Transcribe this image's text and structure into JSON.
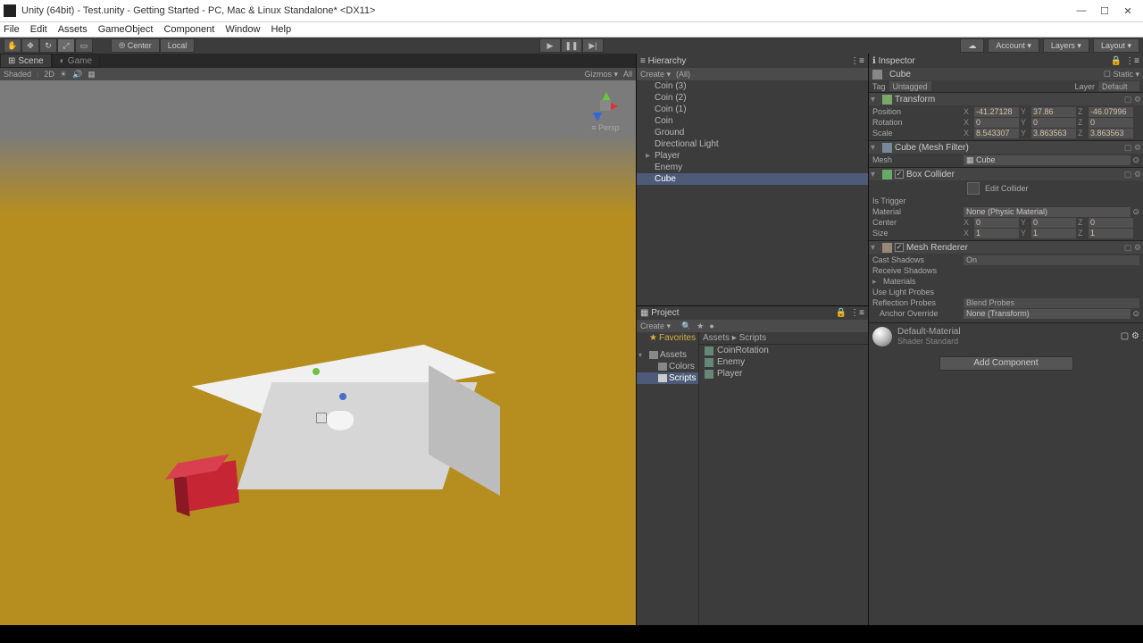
{
  "window": {
    "title": "Unity (64bit) - Test.unity - Getting Started - PC, Mac & Linux Standalone* <DX11>"
  },
  "menu": [
    "File",
    "Edit",
    "Assets",
    "GameObject",
    "Component",
    "Window",
    "Help"
  ],
  "toolbar": {
    "pivot1": "⦾ Center",
    "pivot2": "Local",
    "account": "Account ▾",
    "layers": "Layers ▾",
    "layout": "Layout ▾"
  },
  "tabs": {
    "scene": "Scene",
    "game": "Game"
  },
  "sceneBar": {
    "shaded": "Shaded",
    "twod": "2D",
    "persp": "≡ Persp",
    "gizmos": "Gizmos ▾",
    "search": "All"
  },
  "hierarchy": {
    "title": "Hierarchy",
    "create": "Create ▾",
    "search": "(All)",
    "items": [
      "Coin (3)",
      "Coin (2)",
      "Coin (1)",
      "Coin",
      "Ground",
      "Directional Light",
      "Player",
      "Enemy",
      "Cube"
    ]
  },
  "project": {
    "title": "Project",
    "create": "Create ▾",
    "favorites": "Favorites",
    "assets": "Assets",
    "folders": [
      "Colors",
      "Scripts"
    ],
    "crumb": "Assets ▸ Scripts",
    "files": [
      "CoinRotation",
      "Enemy",
      "Player"
    ]
  },
  "inspector": {
    "title": "Inspector",
    "obj": "Cube",
    "static": "Static ▾",
    "tagLbl": "Tag",
    "tagVal": "Untagged",
    "layerLbl": "Layer",
    "layerVal": "Default",
    "transform": {
      "name": "Transform",
      "position": {
        "lbl": "Position",
        "x": "-41.27128",
        "y": "37.86",
        "z": "-46.07996"
      },
      "rotation": {
        "lbl": "Rotation",
        "x": "0",
        "y": "0",
        "z": "0"
      },
      "scale": {
        "lbl": "Scale",
        "x": "8.543307",
        "y": "3.863563",
        "z": "3.863563"
      }
    },
    "meshFilter": {
      "name": "Cube (Mesh Filter)",
      "meshLbl": "Mesh",
      "meshVal": "Cube"
    },
    "boxCollider": {
      "name": "Box Collider",
      "editLbl": "Edit Collider",
      "isTriggerLbl": "Is Trigger",
      "materialLbl": "Material",
      "materialVal": "None (Physic Material)",
      "centerLbl": "Center",
      "cx": "0",
      "cy": "0",
      "cz": "0",
      "sizeLbl": "Size",
      "sx": "1",
      "sy": "1",
      "sz": "1"
    },
    "meshRenderer": {
      "name": "Mesh Renderer",
      "castLbl": "Cast Shadows",
      "castVal": "On",
      "recvLbl": "Receive Shadows",
      "matsLbl": "Materials",
      "probesLbl": "Use Light Probes",
      "reflLbl": "Reflection Probes",
      "reflVal": "Blend Probes",
      "anchorLbl": "Anchor Override",
      "anchorVal": "None (Transform)"
    },
    "material": {
      "name": "Default-Material",
      "shaderLbl": "Shader",
      "shaderVal": "Standard"
    },
    "addComp": "Add Component"
  }
}
